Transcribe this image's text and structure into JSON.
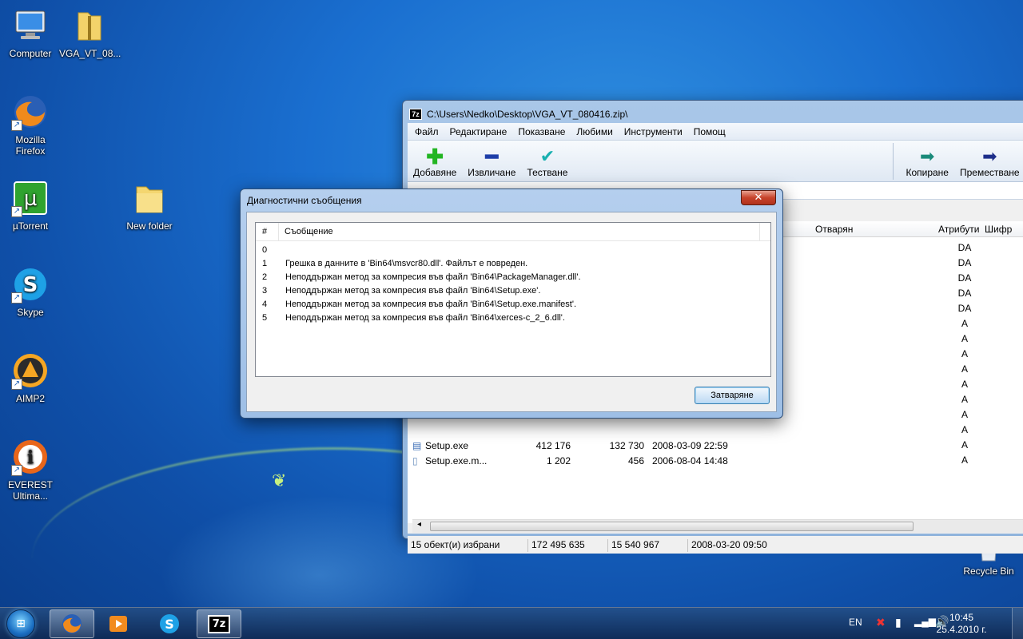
{
  "desktop": {
    "icons": [
      {
        "label": "Computer"
      },
      {
        "label": "VGA_VT_08..."
      },
      {
        "label": "Mozilla Firefox"
      },
      {
        "label": "µTorrent"
      },
      {
        "label": "New folder"
      },
      {
        "label": "Skype"
      },
      {
        "label": "AIMP2"
      },
      {
        "label": "EVEREST Ultima..."
      },
      {
        "label": "Recycle Bin"
      }
    ]
  },
  "sevenzip": {
    "title": "C:\\Users\\Nedko\\Desktop\\VGA_VT_080416.zip\\",
    "app_badge": "7z",
    "menu": [
      "Файл",
      "Редактиране",
      "Показване",
      "Любими",
      "Инструменти",
      "Помощ"
    ],
    "toolbar": {
      "add": "Добавяне",
      "extract": "Извличане",
      "test": "Тестване",
      "copy": "Копиране",
      "move": "Преместване"
    },
    "columns": {
      "opened": "Отварян",
      "attributes": "Атрибути",
      "encrypted": "Шифр"
    },
    "attributes": [
      "DA",
      "DA",
      "DA",
      "DA",
      "DA",
      "A",
      "A",
      "A",
      "A",
      "A",
      "A",
      "A",
      "A",
      "A",
      "A"
    ],
    "files": [
      {
        "name": "Setup.exe",
        "size": "412 176",
        "packed": "132 730",
        "modified": "2008-03-09 22:59"
      },
      {
        "name": "Setup.exe.m...",
        "size": "1 202",
        "packed": "456",
        "modified": "2006-08-04 14:48"
      }
    ],
    "status": {
      "selected": "15 обект(и) избрани",
      "size": "172 495 635",
      "packed": "15 540 967",
      "date": "2008-03-20 09:50"
    }
  },
  "dialog": {
    "title": "Диагностични съобщения",
    "close_glyph": "✕",
    "col_num": "#",
    "col_msg": "Съобщение",
    "messages": [
      {
        "n": "0",
        "text": ""
      },
      {
        "n": "1",
        "text": "Грешка в данните в 'Bin64\\msvcr80.dll'. Файлът е повреден."
      },
      {
        "n": "2",
        "text": "Неподдържан метод за компресия във файл 'Bin64\\PackageManager.dll'."
      },
      {
        "n": "3",
        "text": "Неподдържан метод за компресия във файл 'Bin64\\Setup.exe'."
      },
      {
        "n": "4",
        "text": "Неподдържан метод за компресия във файл 'Bin64\\Setup.exe.manifest'."
      },
      {
        "n": "5",
        "text": "Неподдържан метод за компресия във файл 'Bin64\\xerces-c_2_6.dll'."
      }
    ],
    "close_button": "Затваряне"
  },
  "taskbar": {
    "lang": "EN",
    "time": "10:45",
    "date": "25.4.2010 г.",
    "apps": [
      {
        "name": "firefox",
        "badge": "🦊"
      },
      {
        "name": "media-player",
        "badge": "▶"
      },
      {
        "name": "skype",
        "badge": "S"
      },
      {
        "name": "7zip",
        "badge": "7z"
      }
    ]
  }
}
